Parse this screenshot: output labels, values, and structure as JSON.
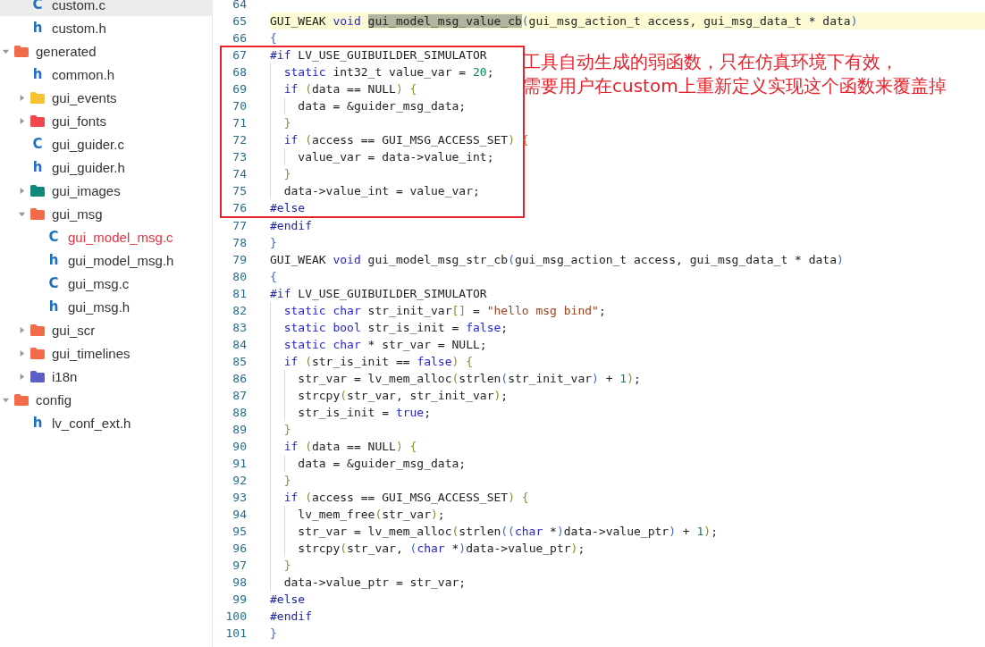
{
  "tree": [
    {
      "children": [
        {
          "kind": "file",
          "icon": "C",
          "label": "custom.c",
          "selected": true,
          "active": false
        },
        {
          "kind": "file",
          "icon": "h",
          "label": "custom.h",
          "selected": false,
          "active": false
        }
      ]
    },
    {
      "kind": "folder",
      "label": "generated",
      "color": "#f26b4b",
      "expanded": true,
      "selected": false,
      "active": false,
      "children": [
        {
          "kind": "file",
          "icon": "h",
          "label": "common.h",
          "selected": false,
          "active": false
        },
        {
          "kind": "folder",
          "label": "gui_events",
          "color": "#f7c232",
          "expanded": false,
          "selected": false,
          "active": false
        },
        {
          "kind": "folder",
          "label": "gui_fonts",
          "color": "#f2474f",
          "expanded": false,
          "selected": false,
          "active": false
        },
        {
          "kind": "file",
          "icon": "C",
          "label": "gui_guider.c",
          "selected": false,
          "active": false
        },
        {
          "kind": "file",
          "icon": "h",
          "label": "gui_guider.h",
          "selected": false,
          "active": false
        },
        {
          "kind": "folder",
          "label": "gui_images",
          "color": "#0f8a7a",
          "expanded": false,
          "selected": false,
          "active": false
        },
        {
          "kind": "folder",
          "label": "gui_msg",
          "color": "#f26b4b",
          "expanded": true,
          "selected": false,
          "active": false,
          "children": [
            {
              "kind": "file",
              "icon": "C",
              "label": "gui_model_msg.c",
              "selected": false,
              "active": true
            },
            {
              "kind": "file",
              "icon": "h",
              "label": "gui_model_msg.h",
              "selected": false,
              "active": false
            },
            {
              "kind": "file",
              "icon": "C",
              "label": "gui_msg.c",
              "selected": false,
              "active": false
            },
            {
              "kind": "file",
              "icon": "h",
              "label": "gui_msg.h",
              "selected": false,
              "active": false
            }
          ]
        },
        {
          "kind": "folder",
          "label": "gui_scr",
          "color": "#f26b4b",
          "expanded": false,
          "selected": false,
          "active": false
        },
        {
          "kind": "folder",
          "label": "gui_timelines",
          "color": "#f26b4b",
          "expanded": false,
          "selected": false,
          "active": false
        },
        {
          "kind": "folder",
          "label": "i18n",
          "color": "#5b5fc7",
          "expanded": false,
          "selected": false,
          "active": false
        }
      ]
    },
    {
      "kind": "folder",
      "label": "config",
      "color": "#f26b4b",
      "expanded": true,
      "selected": false,
      "active": false,
      "children": [
        {
          "kind": "file",
          "icon": "h",
          "label": "lv_conf_ext.h",
          "selected": false,
          "active": false
        }
      ]
    }
  ],
  "editor": {
    "sections": [
      {
        "kind": "plain",
        "lines": [
          {
            "number": "64",
            "current": false
          },
          {
            "number": "65",
            "current": true,
            "tokens": [
              {
                "kind": "plain",
                "text": "GUI_WEAK "
              },
              {
                "kind": "kw",
                "text": "void "
              },
              {
                "kind": "match",
                "text": "gui_model_msg_value_cb"
              },
              {
                "kind": "b1",
                "text": "("
              },
              {
                "kind": "plain",
                "text": "gui_msg_action_t access, gui_msg_data_t * data"
              },
              {
                "kind": "b1",
                "text": ")"
              }
            ]
          },
          {
            "number": "66",
            "current": false,
            "tokens": [
              {
                "kind": "b1",
                "text": "{"
              }
            ]
          }
        ]
      },
      {
        "kind": "boxed",
        "note": [
          "工具自动生成的弱函数，只在仿真环境下有效，",
          "需要用户在custom上重新定义实现这个函数来覆盖掉"
        ],
        "lines": [
          {
            "number": "67",
            "current": false,
            "tokens": [
              {
                "kind": "pp",
                "text": "#if"
              },
              {
                "kind": "plain",
                "text": " LV_USE_GUIBUILDER_SIMULATOR"
              }
            ]
          },
          {
            "number": "68",
            "current": false,
            "tokens": [
              {
                "kind": "kw",
                "text": "  static"
              },
              {
                "kind": "plain",
                "text": " int32_t value_var = "
              },
              {
                "kind": "num",
                "text": "20"
              },
              {
                "kind": "plain",
                "text": ";"
              }
            ]
          },
          {
            "number": "69",
            "current": false,
            "tokens": [
              {
                "kind": "kw",
                "text": "  if "
              },
              {
                "kind": "b2",
                "text": "("
              },
              {
                "kind": "plain",
                "text": "data == NULL"
              },
              {
                "kind": "b2",
                "text": ") {"
              }
            ]
          },
          {
            "number": "70",
            "current": false,
            "tokens": [
              {
                "kind": "plain",
                "text": "    data = &guider_msg_data;"
              }
            ]
          },
          {
            "number": "71",
            "current": false,
            "tokens": [
              {
                "kind": "b2",
                "text": "  }"
              }
            ]
          },
          {
            "number": "72",
            "current": false,
            "tokens": [
              {
                "kind": "kw",
                "text": "  if "
              },
              {
                "kind": "b2",
                "text": "("
              },
              {
                "kind": "plain",
                "text": "access == GUI_MSG_ACCESS_SET"
              },
              {
                "kind": "b2",
                "text": ") {"
              }
            ]
          },
          {
            "number": "73",
            "current": false,
            "tokens": [
              {
                "kind": "plain",
                "text": "    value_var = data->value_int;"
              }
            ]
          },
          {
            "number": "74",
            "current": false,
            "tokens": [
              {
                "kind": "b2",
                "text": "  }"
              }
            ]
          },
          {
            "number": "75",
            "current": false,
            "tokens": [
              {
                "kind": "plain",
                "text": "  data->value_int = value_var;"
              }
            ]
          },
          {
            "number": "76",
            "current": false,
            "tokens": [
              {
                "kind": "pp",
                "text": "#else"
              }
            ]
          }
        ]
      },
      {
        "kind": "plain",
        "lines": [
          {
            "number": "77",
            "current": false,
            "tokens": [
              {
                "kind": "pp",
                "text": "#endif"
              }
            ]
          },
          {
            "number": "78",
            "current": false,
            "tokens": [
              {
                "kind": "b1",
                "text": "}"
              }
            ]
          },
          {
            "number": "79",
            "current": false,
            "tokens": [
              {
                "kind": "plain",
                "text": "GUI_WEAK "
              },
              {
                "kind": "kw",
                "text": "void"
              },
              {
                "kind": "plain",
                "text": " gui_model_msg_str_cb"
              },
              {
                "kind": "b1",
                "text": "("
              },
              {
                "kind": "plain",
                "text": "gui_msg_action_t access, gui_msg_data_t * data"
              },
              {
                "kind": "b1",
                "text": ")"
              }
            ]
          },
          {
            "number": "80",
            "current": false,
            "tokens": [
              {
                "kind": "b1",
                "text": "{"
              }
            ]
          },
          {
            "number": "81",
            "current": false,
            "tokens": [
              {
                "kind": "pp",
                "text": "#if"
              },
              {
                "kind": "plain",
                "text": " LV_USE_GUIBUILDER_SIMULATOR"
              }
            ]
          },
          {
            "number": "82",
            "current": false,
            "tokens": [
              {
                "kind": "kw",
                "text": "  static char"
              },
              {
                "kind": "plain",
                "text": " str_init_var"
              },
              {
                "kind": "b2",
                "text": "[]"
              },
              {
                "kind": "plain",
                "text": " = "
              },
              {
                "kind": "str",
                "text": "\"hello msg bind\""
              },
              {
                "kind": "plain",
                "text": ";"
              }
            ]
          },
          {
            "number": "83",
            "current": false,
            "tokens": [
              {
                "kind": "kw",
                "text": "  static bool"
              },
              {
                "kind": "plain",
                "text": " str_is_init = "
              },
              {
                "kind": "kw",
                "text": "false"
              },
              {
                "kind": "plain",
                "text": ";"
              }
            ]
          },
          {
            "number": "84",
            "current": false,
            "tokens": [
              {
                "kind": "kw",
                "text": "  static char"
              },
              {
                "kind": "plain",
                "text": " * str_var = NULL;"
              }
            ]
          },
          {
            "number": "85",
            "current": false,
            "tokens": [
              {
                "kind": "kw",
                "text": "  if "
              },
              {
                "kind": "b2",
                "text": "("
              },
              {
                "kind": "plain",
                "text": "str_is_init == "
              },
              {
                "kind": "kw",
                "text": "false"
              },
              {
                "kind": "b2",
                "text": ") {"
              }
            ]
          },
          {
            "number": "86",
            "current": false,
            "tokens": [
              {
                "kind": "plain",
                "text": "    str_var = lv_mem_alloc"
              },
              {
                "kind": "b2",
                "text": "("
              },
              {
                "kind": "plain",
                "text": "strlen"
              },
              {
                "kind": "b1",
                "text": "("
              },
              {
                "kind": "plain",
                "text": "str_init_var"
              },
              {
                "kind": "b1",
                "text": ")"
              },
              {
                "kind": "plain",
                "text": " + "
              },
              {
                "kind": "num",
                "text": "1"
              },
              {
                "kind": "b2",
                "text": ")"
              },
              {
                "kind": "plain",
                "text": ";"
              }
            ]
          },
          {
            "number": "87",
            "current": false,
            "tokens": [
              {
                "kind": "plain",
                "text": "    strcpy"
              },
              {
                "kind": "b2",
                "text": "("
              },
              {
                "kind": "plain",
                "text": "str_var, str_init_var"
              },
              {
                "kind": "b2",
                "text": ")"
              },
              {
                "kind": "plain",
                "text": ";"
              }
            ]
          },
          {
            "number": "88",
            "current": false,
            "tokens": [
              {
                "kind": "plain",
                "text": "    str_is_init = "
              },
              {
                "kind": "kw",
                "text": "true"
              },
              {
                "kind": "plain",
                "text": ";"
              }
            ]
          },
          {
            "number": "89",
            "current": false,
            "tokens": [
              {
                "kind": "b2",
                "text": "  }"
              }
            ]
          },
          {
            "number": "90",
            "current": false,
            "tokens": [
              {
                "kind": "kw",
                "text": "  if "
              },
              {
                "kind": "b2",
                "text": "("
              },
              {
                "kind": "plain",
                "text": "data == NULL"
              },
              {
                "kind": "b2",
                "text": ") {"
              }
            ]
          },
          {
            "number": "91",
            "current": false,
            "tokens": [
              {
                "kind": "plain",
                "text": "    data = &guider_msg_data;"
              }
            ]
          },
          {
            "number": "92",
            "current": false,
            "tokens": [
              {
                "kind": "b2",
                "text": "  }"
              }
            ]
          },
          {
            "number": "93",
            "current": false,
            "tokens": [
              {
                "kind": "kw",
                "text": "  if "
              },
              {
                "kind": "b2",
                "text": "("
              },
              {
                "kind": "plain",
                "text": "access == GUI_MSG_ACCESS_SET"
              },
              {
                "kind": "b2",
                "text": ") {"
              }
            ]
          },
          {
            "number": "94",
            "current": false,
            "tokens": [
              {
                "kind": "plain",
                "text": "    lv_mem_free"
              },
              {
                "kind": "b2",
                "text": "("
              },
              {
                "kind": "plain",
                "text": "str_var"
              },
              {
                "kind": "b2",
                "text": ")"
              },
              {
                "kind": "plain",
                "text": ";"
              }
            ]
          },
          {
            "number": "95",
            "current": false,
            "tokens": [
              {
                "kind": "plain",
                "text": "    str_var = lv_mem_alloc"
              },
              {
                "kind": "b2",
                "text": "("
              },
              {
                "kind": "plain",
                "text": "strlen"
              },
              {
                "kind": "b1",
                "text": "(("
              },
              {
                "kind": "kw",
                "text": "char"
              },
              {
                "kind": "plain",
                "text": " *"
              },
              {
                "kind": "b1",
                "text": ")"
              },
              {
                "kind": "plain",
                "text": "data->value_ptr"
              },
              {
                "kind": "b1",
                "text": ")"
              },
              {
                "kind": "plain",
                "text": " + "
              },
              {
                "kind": "num",
                "text": "1"
              },
              {
                "kind": "b2",
                "text": ")"
              },
              {
                "kind": "plain",
                "text": ";"
              }
            ]
          },
          {
            "number": "96",
            "current": false,
            "tokens": [
              {
                "kind": "plain",
                "text": "    strcpy"
              },
              {
                "kind": "b2",
                "text": "("
              },
              {
                "kind": "plain",
                "text": "str_var, "
              },
              {
                "kind": "b1",
                "text": "("
              },
              {
                "kind": "kw",
                "text": "char"
              },
              {
                "kind": "plain",
                "text": " *"
              },
              {
                "kind": "b1",
                "text": ")"
              },
              {
                "kind": "plain",
                "text": "data->value_ptr"
              },
              {
                "kind": "b2",
                "text": ")"
              },
              {
                "kind": "plain",
                "text": ";"
              }
            ]
          },
          {
            "number": "97",
            "current": false,
            "tokens": [
              {
                "kind": "b2",
                "text": "  }"
              }
            ]
          },
          {
            "number": "98",
            "current": false,
            "tokens": [
              {
                "kind": "plain",
                "text": "  data->value_ptr = str_var;"
              }
            ]
          },
          {
            "number": "99",
            "current": false,
            "tokens": [
              {
                "kind": "pp",
                "text": "#else"
              }
            ]
          },
          {
            "number": "100",
            "current": false,
            "tokens": [
              {
                "kind": "pp",
                "text": "#endif"
              }
            ]
          },
          {
            "number": "101",
            "current": false,
            "tokens": [
              {
                "kind": "b1",
                "text": "}"
              }
            ]
          }
        ]
      }
    ]
  }
}
